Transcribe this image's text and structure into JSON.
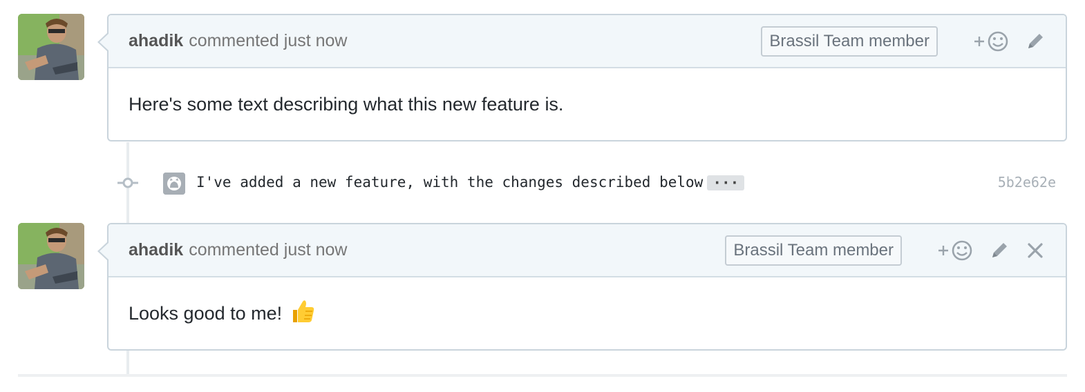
{
  "comments": [
    {
      "author": "ahadik",
      "meta": "commented just now",
      "badge": "Brassil Team member",
      "body": "Here's some text describing what this new feature is.",
      "actions": [
        "add-reaction-icon",
        "pencil-icon"
      ]
    },
    {
      "author": "ahadik",
      "meta": "commented just now",
      "badge": "Brassil Team member",
      "body": "Looks good to me!",
      "emoji": "thumbs-up",
      "actions": [
        "add-reaction-icon",
        "pencil-icon",
        "close-icon"
      ]
    }
  ],
  "commit": {
    "message": "I've added a new feature, with the changes described below",
    "ellipsis": "···",
    "sha": "5b2e62e",
    "icon": "github-octocat-icon"
  },
  "colors": {
    "header_bg": "#f2f7fa",
    "border": "#c9d4dc",
    "muted_text": "#767676",
    "sha_text": "#a8b0b7"
  }
}
